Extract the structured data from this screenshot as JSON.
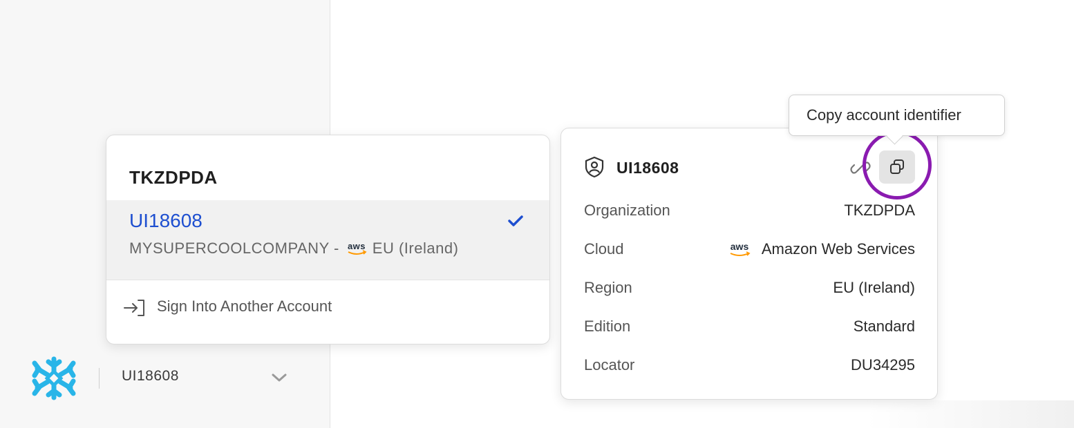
{
  "sidebar": {
    "account_label": "UI18608"
  },
  "switcher": {
    "org_name": "TKZDPDA",
    "selected_account": {
      "name": "UI18608",
      "company": "MYSUPERCOOLCOMPANY -",
      "region": "EU (Ireland)",
      "cloud_icon": "aws-icon",
      "selected": true
    },
    "sign_in_label": "Sign Into Another Account"
  },
  "details": {
    "title": "UI18608",
    "rows": [
      {
        "label": "Organization",
        "value": "TKZDPDA"
      },
      {
        "label": "Cloud",
        "value": "Amazon Web Services",
        "icon": "aws-icon"
      },
      {
        "label": "Region",
        "value": "EU (Ireland)"
      },
      {
        "label": "Edition",
        "value": "Standard"
      },
      {
        "label": "Locator",
        "value": "DU34295"
      }
    ]
  },
  "tooltip": {
    "text": "Copy account identifier"
  },
  "colors": {
    "accent_blue": "#1e4fd0",
    "highlight_ring": "#8a1bb0",
    "logo_blue": "#29b5e8",
    "aws_orange": "#ff9900"
  }
}
